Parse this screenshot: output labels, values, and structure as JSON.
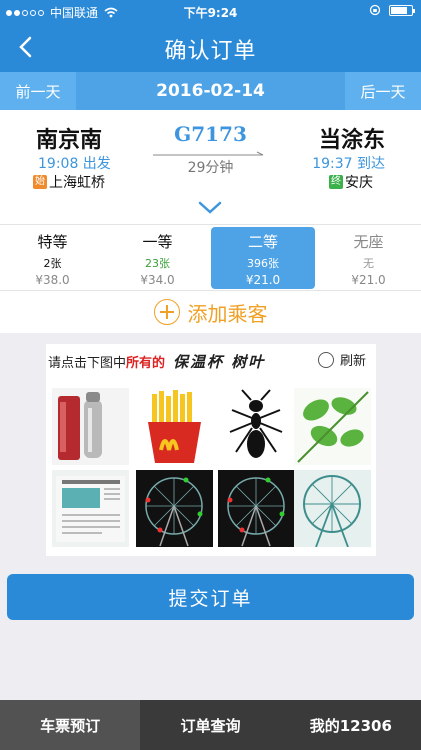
{
  "status_bar": {
    "carrier": "中国联通",
    "time": "下午9:24"
  },
  "nav": {
    "title": "确认订单"
  },
  "date_bar": {
    "prev": "前一天",
    "date": "2016-02-14",
    "next": "后一天"
  },
  "train": {
    "number": "G7173",
    "duration": "29分钟",
    "from": {
      "station": "南京南",
      "time": "19:08 出发",
      "badge": "始",
      "city": "上海虹桥"
    },
    "to": {
      "station": "当涂东",
      "time": "19:37 到达",
      "badge": "终",
      "city": "安庆"
    }
  },
  "seats": [
    {
      "name": "特等",
      "count": "2张",
      "price": "¥38.0",
      "selected": false
    },
    {
      "name": "一等",
      "count": "23张",
      "price": "¥34.0",
      "selected": false
    },
    {
      "name": "二等",
      "count": "396张",
      "price": "¥21.0",
      "selected": true
    },
    {
      "name": "无座",
      "count": "无",
      "price": "¥21.0",
      "selected": false
    }
  ],
  "add_passenger": "添加乘客",
  "captcha": {
    "prompt_pre": "请点击下图中",
    "prompt_bold": "所有的",
    "target": "保温杯 树叶",
    "refresh": "刷新",
    "cells": [
      "thermos",
      "fries",
      "ant",
      "leaves",
      "newspaper",
      "ferris-wheel",
      "ferris-wheel",
      "ferris-wheel"
    ]
  },
  "submit": "提交订单",
  "tabs": [
    "车票预订",
    "订单查询",
    "我的12306"
  ],
  "colors": {
    "primary": "#2b8ad8",
    "accent": "#f0a125",
    "start_badge": "#ef8a2d",
    "end_badge": "#3cb04a"
  }
}
